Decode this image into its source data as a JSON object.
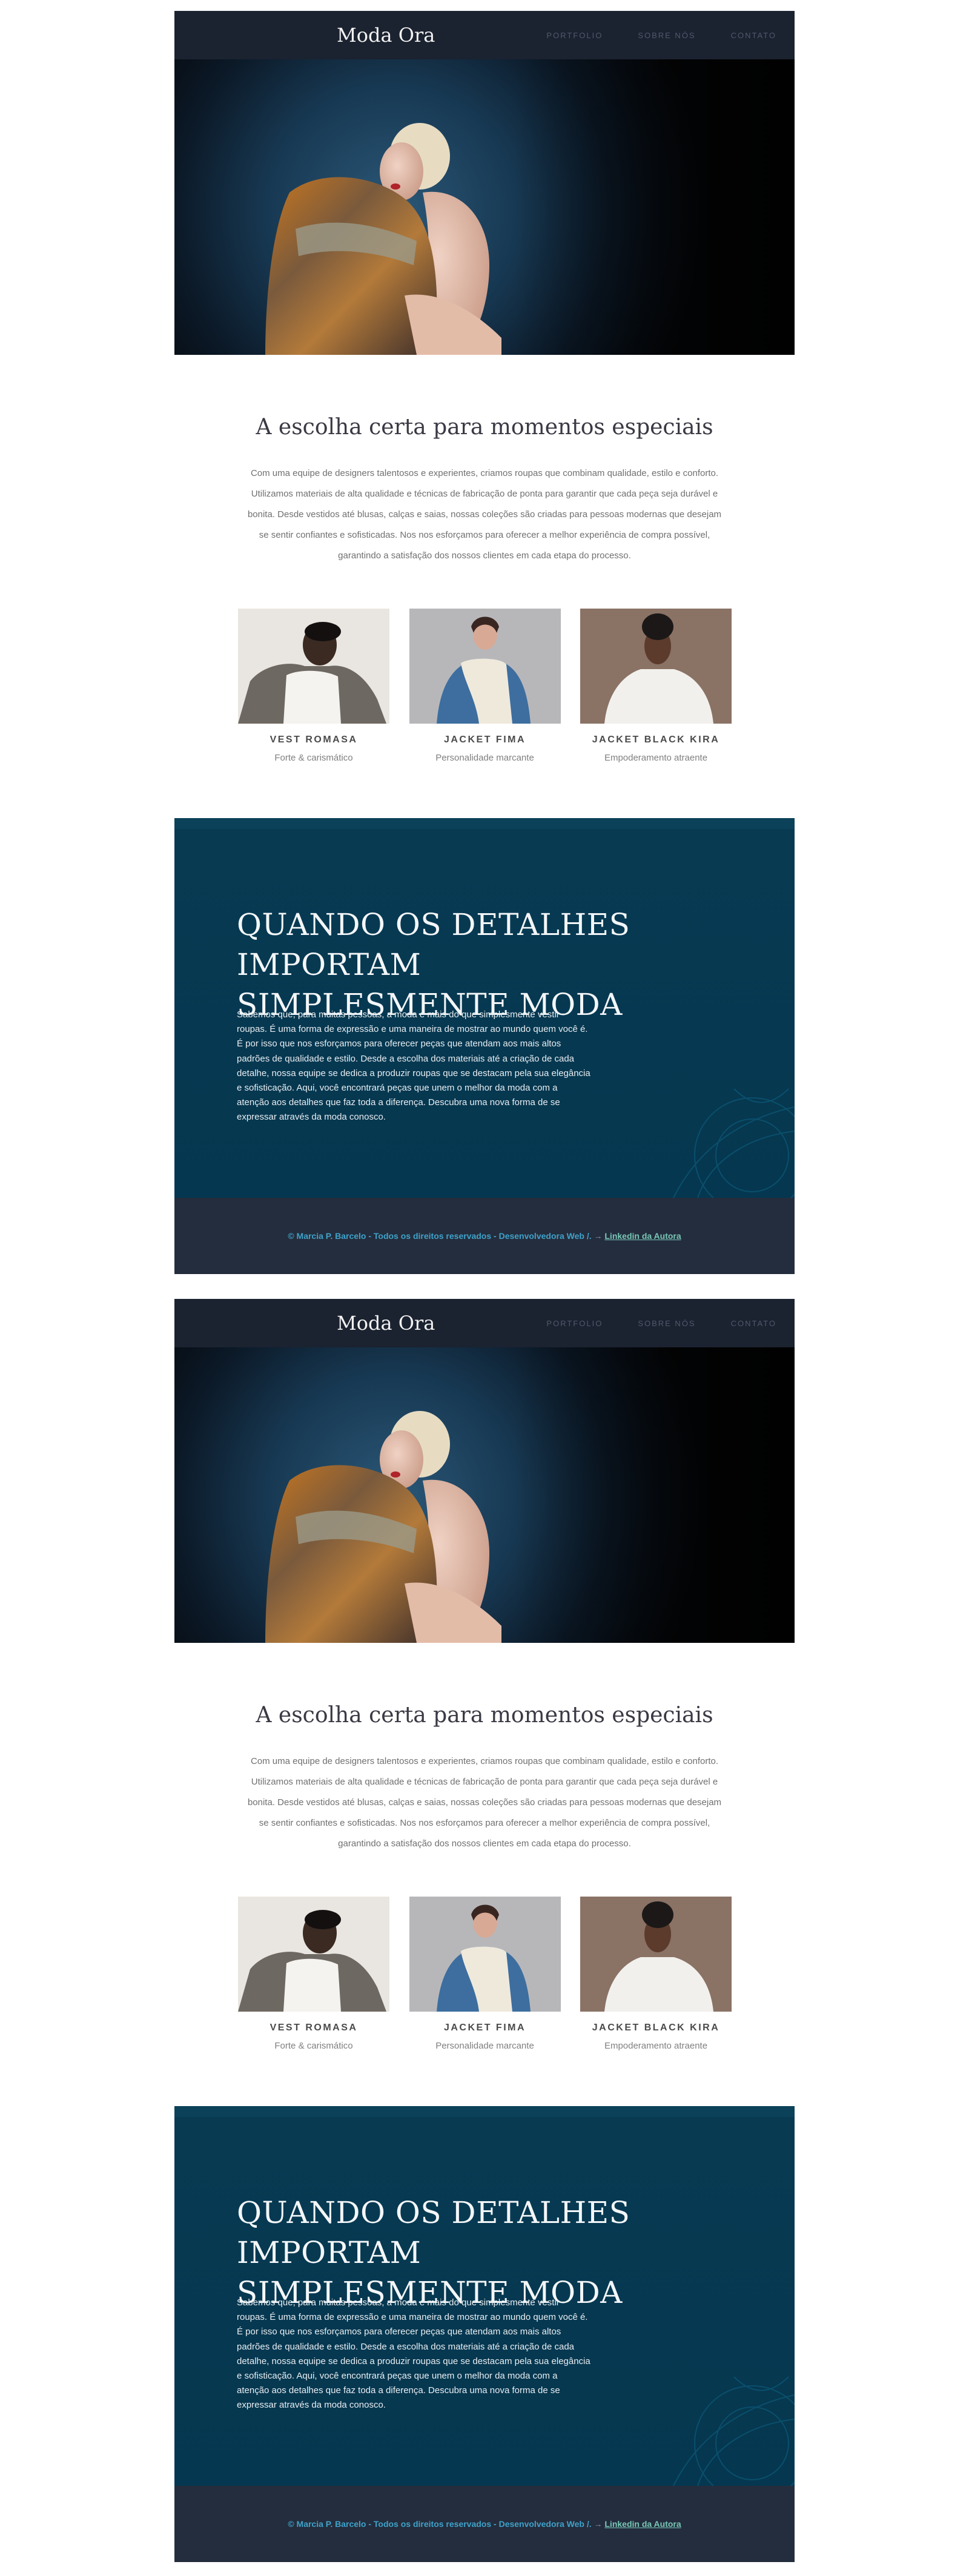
{
  "header": {
    "brand": "Moda Ora",
    "nav": [
      "PORTFOLIO",
      "SOBRE NÓS",
      "CONTATO"
    ]
  },
  "intro": {
    "title": "A escolha certa para momentos especiais",
    "text": "Com uma equipe de designers talentosos e experientes, criamos roupas que combinam qualidade, estilo e conforto. Utilizamos materiais de alta qualidade e técnicas de fabricação de ponta para garantir que cada peça seja durável e bonita. Desde vestidos até blusas, calças e saias, nossas coleções são criadas para pessoas modernas que desejam se sentir confiantes e sofisticadas. Nos nos esforçamos para oferecer a melhor experiência de compra possível, garantindo a satisfação dos nossos clientes em cada etapa do processo."
  },
  "products": [
    {
      "name": "VEST ROMASA",
      "desc": "Forte & carismático"
    },
    {
      "name": "JACKET FIMA",
      "desc": "Personalidade marcante"
    },
    {
      "name": "JACKET BLACK KIRA",
      "desc": "Empoderamento atraente"
    }
  ],
  "feature": {
    "title_line1": "QUANDO OS DETALHES IMPORTAM",
    "title_line2": "SIMPLESMENTE MODA",
    "text": "Sabemos que, para muitas pessoas, a moda é mais do que simplesmente vestir roupas. É uma forma de expressão e uma maneira de mostrar ao mundo quem você é. É por isso que nos esforçamos para oferecer peças que atendam aos mais altos padrões de qualidade e estilo. Desde a escolha dos materiais até a criação de cada detalhe, nossa equipe se dedica a produzir roupas que se destacam pela sua elegância e sofisticação. Aqui, você encontrará peças que unem o melhor da moda com a atenção aos detalhes que faz toda a diferença. Descubra uma nova forma de se expressar através da moda conosco."
  },
  "footer": {
    "text": "© Marcia P. Barcelo - Todos os direitos reservados - Desenvolvedora Web /.",
    "arrow": "→",
    "link": "Linkedin da Autora"
  },
  "colors": {
    "header_bg": "#1b2230",
    "feature_bg": "#053750",
    "footer_bg": "#242d3d",
    "footer_text": "#3fa2c9",
    "footer_link": "#79c7b7"
  },
  "icons": [
    "hero-photo",
    "product-photo"
  ]
}
